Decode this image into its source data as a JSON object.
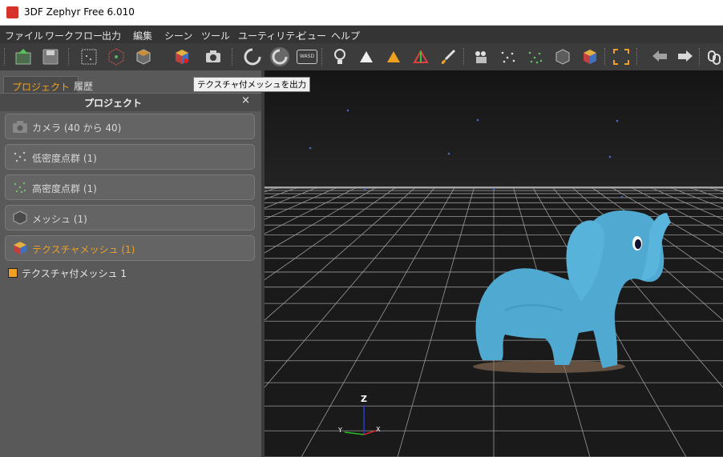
{
  "window": {
    "title": "3DF Zephyr Free 6.010"
  },
  "menu": [
    "ファイル",
    "ワークフロー",
    "出力",
    "編集",
    "シーン",
    "ツール",
    "ユーティリティ",
    "ビュー",
    "ヘルプ"
  ],
  "toolbar": {
    "tooltip": "テクスチャ付メッシュを出力",
    "wasd_label": "WASD",
    "highlight_color": "#e01818"
  },
  "panel": {
    "tabs": [
      "プロジェクト",
      "履歴"
    ],
    "title": "プロジェクト",
    "close_glyph": "×",
    "sections": [
      {
        "label": "カメラ (40 から 40)",
        "icon": "camera-icon"
      },
      {
        "label": "低密度点群 (1)",
        "icon": "sparse-cloud-icon"
      },
      {
        "label": "高密度点群 (1)",
        "icon": "dense-cloud-icon"
      },
      {
        "label": "メッシュ (1)",
        "icon": "mesh-icon"
      },
      {
        "label": "テクスチャメッシュ (1)",
        "icon": "textured-mesh-icon",
        "active": true
      }
    ],
    "tree_item": "テクスチャ付メッシュ 1"
  },
  "viewport": {
    "axis_labels": {
      "z": "Z",
      "y": "Y",
      "x": "X"
    },
    "model_color": "#4ea9cf"
  },
  "colors": {
    "accent": "#f0a020",
    "panel_bg": "#595959",
    "toolbar_bg": "#3c3c3c"
  }
}
